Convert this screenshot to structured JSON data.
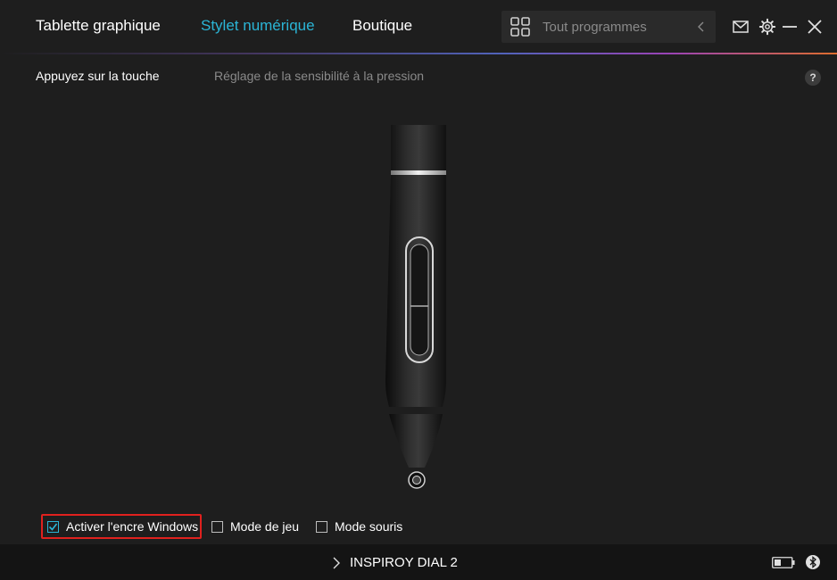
{
  "nav": {
    "tabs": [
      {
        "label": "Tablette graphique"
      },
      {
        "label": "Stylet numérique"
      },
      {
        "label": "Boutique"
      }
    ],
    "active_tab": "Stylet numérique",
    "search": {
      "placeholder": "Tout programmes"
    }
  },
  "subtabs": [
    {
      "label": "Appuyez sur la touche"
    },
    {
      "label": "Réglage de la sensibilité à la pression"
    }
  ],
  "help_label": "?",
  "options": [
    {
      "label": "Activer l'encre Windows",
      "checked": true
    },
    {
      "label": "Mode de jeu",
      "checked": false
    },
    {
      "label": "Mode souris",
      "checked": false
    }
  ],
  "status": {
    "device": "INSPIROY DIAL 2"
  },
  "colors": {
    "accent": "#2bb5d6",
    "highlight": "#e0211e",
    "background": "#1e1e1e",
    "statusbar": "#141414"
  },
  "icons": [
    "grid-icon",
    "chevron-left-icon",
    "mail-icon",
    "gear-icon",
    "minimize-icon",
    "close-icon",
    "chevron-right-icon",
    "battery-icon",
    "bluetooth-icon",
    "help-icon"
  ]
}
